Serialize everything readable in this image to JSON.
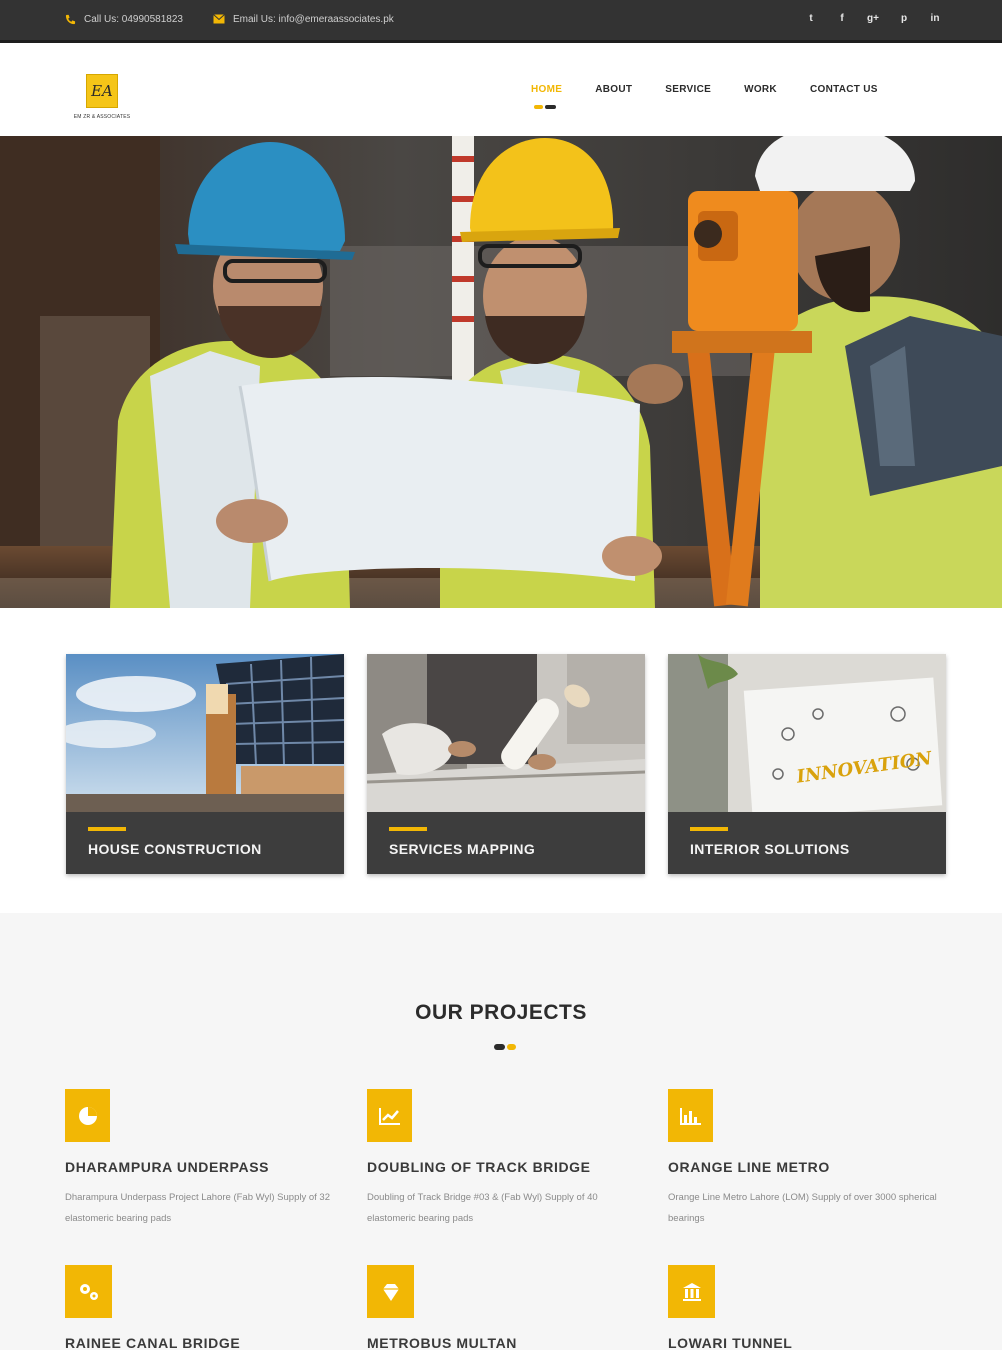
{
  "topbar": {
    "phone_text": "Call Us: 04990581823",
    "email_text": "Email Us: info@emeraassociates.pk",
    "social_icons": [
      "twitter-icon",
      "facebook-icon",
      "google-plus-icon",
      "pinterest-icon",
      "linkedin-icon"
    ],
    "social_glyphs": [
      "t",
      "f",
      "g+",
      "p",
      "in"
    ]
  },
  "header": {
    "logo_mark": "EA",
    "logo_text": "EM ZR & ASSOCIATES",
    "nav": [
      {
        "label": "HOME",
        "active": true
      },
      {
        "label": "ABOUT",
        "active": false
      },
      {
        "label": "SERVICE",
        "active": false
      },
      {
        "label": "WORK",
        "active": false
      },
      {
        "label": "CONTACT US",
        "active": false
      }
    ]
  },
  "services": [
    {
      "title": "HOUSE CONSTRUCTION"
    },
    {
      "title": "SERVICES MAPPING"
    },
    {
      "title": "INTERIOR SOLUTIONS",
      "image_text": "INNOVATION"
    }
  ],
  "projects": {
    "heading": "OUR PROJECTS",
    "items": [
      {
        "name": "DHARAMPURA UNDERPASS",
        "desc": "Dharampura Underpass Project Lahore (Fab Wyl) Supply of 32 elastomeric bearing pads",
        "icon": "pie-chart-icon"
      },
      {
        "name": "DOUBLING OF TRACK BRIDGE",
        "desc": "Doubling of Track Bridge #03 & (Fab Wyl) Supply of 40 elastomeric bearing pads",
        "icon": "line-chart-icon"
      },
      {
        "name": "ORANGE LINE METRO",
        "desc": "Orange Line Metro Lahore (LOM) Supply of over 3000 spherical bearings",
        "icon": "bar-chart-icon"
      },
      {
        "name": "RAINEE CANAL BRIDGE",
        "desc": "",
        "icon": "gears-icon"
      },
      {
        "name": "METROBUS MULTAN",
        "desc": "",
        "icon": "diamond-icon"
      },
      {
        "name": "LOWARI TUNNEL",
        "desc": "",
        "icon": "building-icon"
      }
    ]
  },
  "colors": {
    "accent": "#f2b705",
    "dark": "#333333",
    "caption_bg": "#3d3d3d",
    "section_bg": "#f6f6f6"
  }
}
